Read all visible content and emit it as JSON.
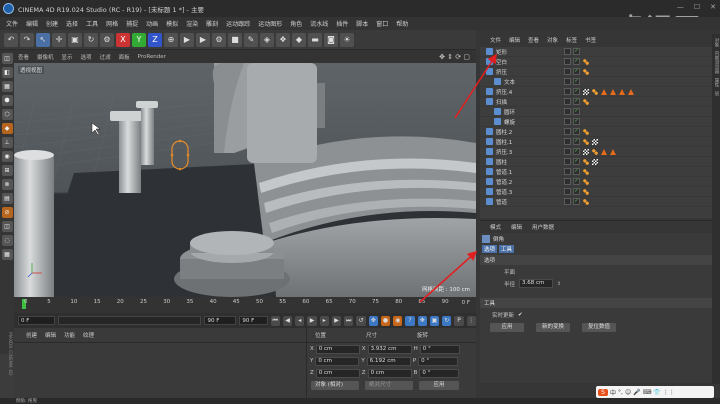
{
  "window": {
    "title": "CINEMA 4D R19.024 Studio (RC - R19) - [未标题 1 *] - 主要",
    "watermark": "虎课网"
  },
  "menubar": [
    "文件",
    "编辑",
    "创建",
    "选择",
    "工具",
    "网格",
    "捕捉",
    "动画",
    "模拟",
    "渲染",
    "雕刻",
    "运动跟踪",
    "运动图形",
    "角色",
    "流水线",
    "插件",
    "脚本",
    "窗口",
    "帮助"
  ],
  "toolbar": {
    "axis_x": "X",
    "axis_y": "Y",
    "axis_z": "Z"
  },
  "viewport": {
    "menu": [
      "查看",
      "摄像机",
      "显示",
      "选项",
      "过滤",
      "面板",
      "ProRender"
    ],
    "label": "透视视图",
    "grid_distance": "网格间距 : 100 cm"
  },
  "timeline": {
    "ticks": [
      "0",
      "5",
      "10",
      "15",
      "20",
      "25",
      "30",
      "35",
      "40",
      "45",
      "50",
      "55",
      "60",
      "65",
      "70",
      "75",
      "80",
      "85",
      "90"
    ],
    "current_frame": "0 F",
    "start_field": "0 F",
    "end_field": "90 F",
    "end_field2": "90 F"
  },
  "material_panel": {
    "menu": [
      "创建",
      "编辑",
      "功能",
      "纹理"
    ],
    "side_label": "MAXON CINEMA 4D"
  },
  "coordinates": {
    "headers": [
      "位置",
      "尺寸",
      "旋转"
    ],
    "rows": [
      {
        "axis": "X",
        "pos": "0 cm",
        "size_axis": "X",
        "size": "3.932 cm",
        "rot_axis": "H",
        "rot": "0 °"
      },
      {
        "axis": "Y",
        "pos": "0 cm",
        "size_axis": "Y",
        "size": "6.192 cm",
        "rot_axis": "P",
        "rot": "0 °"
      },
      {
        "axis": "Z",
        "pos": "0 cm",
        "size_axis": "Z",
        "size": "0 cm",
        "rot_axis": "B",
        "rot": "0 °"
      }
    ],
    "object_mode": "对象 (相对)",
    "size_mode": "绝对尺寸",
    "apply": "应用"
  },
  "object_manager": {
    "menu": [
      "文件",
      "编辑",
      "查看",
      "对象",
      "标签",
      "书签"
    ],
    "objects": [
      {
        "name": "矩形",
        "indent": 0,
        "tags": []
      },
      {
        "name": "空白",
        "indent": 0,
        "tags": [
          "dots"
        ]
      },
      {
        "name": "挤压",
        "indent": 0,
        "tags": [
          "dots"
        ]
      },
      {
        "name": "文本",
        "indent": 1,
        "tags": []
      },
      {
        "name": "挤压.4",
        "indent": 0,
        "tags": [
          "chk2",
          "dots",
          "tri",
          "tri",
          "tri",
          "tri"
        ]
      },
      {
        "name": "扫描",
        "indent": 0,
        "tags": [
          "dots"
        ]
      },
      {
        "name": "圆环",
        "indent": 1,
        "tags": []
      },
      {
        "name": "螺旋",
        "indent": 1,
        "tags": []
      },
      {
        "name": "圆柱.2",
        "indent": 0,
        "tags": [
          "dots"
        ]
      },
      {
        "name": "圆柱.1",
        "indent": 0,
        "tags": [
          "dots",
          "chk2"
        ]
      },
      {
        "name": "挤压.3",
        "indent": 0,
        "tags": [
          "chk2",
          "dots",
          "tri",
          "tri"
        ]
      },
      {
        "name": "圆柱",
        "indent": 0,
        "tags": [
          "dots",
          "chk2"
        ]
      },
      {
        "name": "管道.1",
        "indent": 0,
        "tags": [
          "dots"
        ]
      },
      {
        "name": "管道.2",
        "indent": 0,
        "tags": [
          "dots"
        ]
      },
      {
        "name": "管道.3",
        "indent": 0,
        "tags": [
          "dots"
        ]
      },
      {
        "name": "管道",
        "indent": 0,
        "tags": [
          "dots"
        ]
      }
    ]
  },
  "attributes": {
    "menu": [
      "模式",
      "编辑",
      "用户数据"
    ],
    "tool_name": "倒角",
    "tabs": [
      "选项",
      "工具"
    ],
    "section_options": "选项",
    "flat_label": "平面",
    "flat_value": "",
    "radius_label": "半径",
    "radius_value": "3.68 cm",
    "section_tool": "工具",
    "realtime_label": "实时更新",
    "apply_btn": "应用",
    "new_transform_btn": "新的变换",
    "reset_btn": "复位数值"
  },
  "ime": {
    "items": [
      "S",
      "中",
      "°,",
      "☺",
      "🎤",
      "⌨",
      "👕",
      "⋮⋮"
    ]
  },
  "statusbar": "倒角: 拖曳"
}
